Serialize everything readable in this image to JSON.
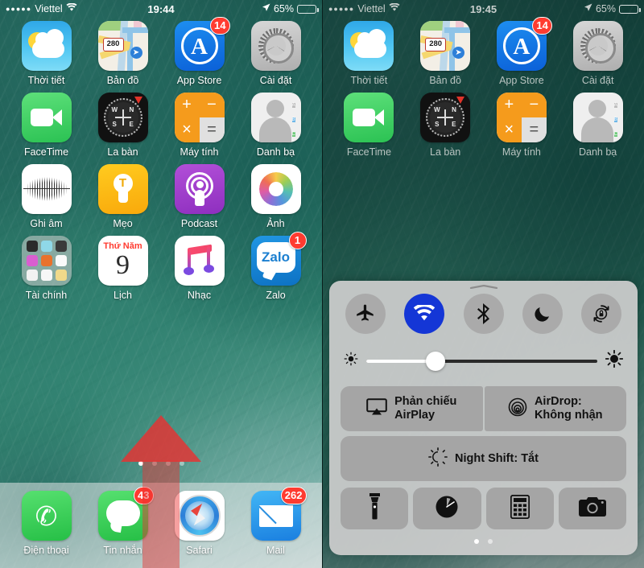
{
  "left_screen": {
    "status_bar": {
      "signal_dots": "●●●●●",
      "carrier": "Viettel",
      "wifi_icon": "wifi-icon",
      "time": "19:44",
      "location_icon": "location-arrow-icon",
      "battery_percent": "65%",
      "battery_level": 65
    },
    "apps": [
      {
        "label": "Thời tiết",
        "icon": "weather-icon",
        "badge": null
      },
      {
        "label": "Bản đồ",
        "icon": "maps-icon",
        "badge": null,
        "shield_text": "280"
      },
      {
        "label": "App Store",
        "icon": "app-store-icon",
        "badge": "14"
      },
      {
        "label": "Cài đặt",
        "icon": "settings-icon",
        "badge": null
      },
      {
        "label": "FaceTime",
        "icon": "facetime-icon",
        "badge": null
      },
      {
        "label": "La bàn",
        "icon": "compass-icon",
        "badge": null
      },
      {
        "label": "Máy tính",
        "icon": "calculator-icon",
        "badge": null
      },
      {
        "label": "Danh bạ",
        "icon": "contacts-icon",
        "badge": null
      },
      {
        "label": "Ghi âm",
        "icon": "voice-memos-icon",
        "badge": null
      },
      {
        "label": "Mẹo",
        "icon": "tips-icon",
        "badge": null
      },
      {
        "label": "Podcast",
        "icon": "podcasts-icon",
        "badge": null
      },
      {
        "label": "Ảnh",
        "icon": "photos-icon",
        "badge": null
      },
      {
        "label": "Tài chính",
        "icon": "folder-icon",
        "badge": null
      },
      {
        "label": "Lịch",
        "icon": "calendar-icon",
        "badge": null,
        "weekday": "Thứ Năm",
        "day": "9"
      },
      {
        "label": "Nhạc",
        "icon": "music-icon",
        "badge": null
      },
      {
        "label": "Zalo",
        "icon": "zalo-icon",
        "badge": "1",
        "wordmark": "Zalo"
      }
    ],
    "compass_labels": {
      "n": "N",
      "w": "W",
      "s": "S",
      "e": "E"
    },
    "calculator_keys": {
      "plus": "+",
      "minus": "−",
      "times": "×",
      "equals": "="
    },
    "contacts_tabs": [
      "A",
      "B",
      "C",
      "D"
    ],
    "page_dots": {
      "count": 4,
      "active_index": 0
    },
    "dock": [
      {
        "label": "Điện thoại",
        "icon": "phone-icon",
        "badge": null
      },
      {
        "label": "Tin nhắn",
        "icon": "messages-icon",
        "badge": "43"
      },
      {
        "label": "Safari",
        "icon": "safari-icon",
        "badge": null
      },
      {
        "label": "Mail",
        "icon": "mail-icon",
        "badge": "262"
      }
    ],
    "annotation": {
      "name": "swipe-up-arrow",
      "color": "#eb3030",
      "direction": "up"
    }
  },
  "right_screen": {
    "status_bar": {
      "signal_dots": "●●●●●",
      "carrier": "Viettel",
      "wifi_icon": "wifi-icon",
      "time": "19:45",
      "location_icon": "location-arrow-icon",
      "battery_percent": "65%",
      "battery_level": 65
    },
    "apps": [
      {
        "label": "Thời tiết",
        "icon": "weather-icon"
      },
      {
        "label": "Bản đồ",
        "icon": "maps-icon",
        "shield_text": "280"
      },
      {
        "label": "App Store",
        "icon": "app-store-icon",
        "badge": "14"
      },
      {
        "label": "Cài đặt",
        "icon": "settings-icon"
      },
      {
        "label": "FaceTime",
        "icon": "facetime-icon"
      },
      {
        "label": "La bàn",
        "icon": "compass-icon"
      },
      {
        "label": "Máy tính",
        "icon": "calculator-icon"
      },
      {
        "label": "Danh bạ",
        "icon": "contacts-icon"
      }
    ],
    "control_center": {
      "toggles": [
        {
          "name": "airplane-mode-toggle",
          "icon": "airplane-icon",
          "state": "off"
        },
        {
          "name": "wifi-toggle",
          "icon": "wifi-icon",
          "state": "on"
        },
        {
          "name": "bluetooth-toggle",
          "icon": "bluetooth-icon",
          "state": "off"
        },
        {
          "name": "do-not-disturb-toggle",
          "icon": "moon-icon",
          "state": "off"
        },
        {
          "name": "rotation-lock-toggle",
          "icon": "rotation-lock-icon",
          "state": "off"
        }
      ],
      "brightness": {
        "label_low": "brightness-low-icon",
        "label_high": "brightness-high-icon",
        "value": 30
      },
      "airplay": {
        "label_line1": "Phản chiếu",
        "label_line2": "AirPlay",
        "icon": "airplay-icon"
      },
      "airdrop": {
        "label_line1": "AirDrop:",
        "label_line2": "Không nhận",
        "icon": "airdrop-icon"
      },
      "night_shift": {
        "label": "Night Shift: Tắt",
        "icon": "night-shift-icon"
      },
      "shortcuts": [
        {
          "name": "flashlight-button",
          "icon": "flashlight-icon"
        },
        {
          "name": "timer-button",
          "icon": "timer-icon"
        },
        {
          "name": "calculator-button",
          "icon": "calculator-icon"
        },
        {
          "name": "camera-button",
          "icon": "camera-icon"
        }
      ],
      "page_dots": {
        "count": 2,
        "active_index": 0
      }
    },
    "annotation": {
      "name": "point-to-wifi-arrow",
      "color": "#eb3030",
      "direction": "left"
    }
  }
}
